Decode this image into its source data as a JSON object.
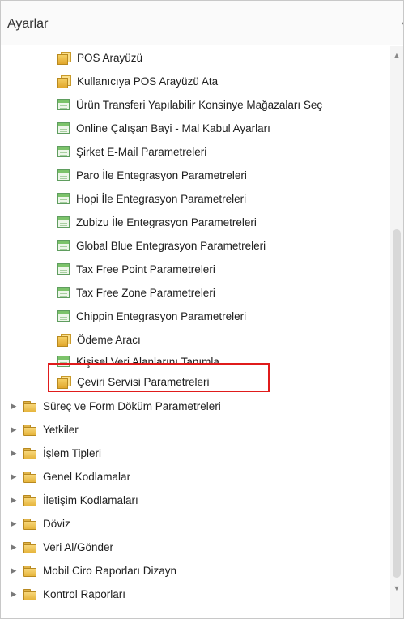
{
  "panel": {
    "title": "Ayarlar",
    "collapse_glyph": "‹"
  },
  "tree": {
    "items": [
      {
        "label": "POS Arayüzü",
        "icon": "book-icon"
      },
      {
        "label": "Kullanıcıya POS Arayüzü Ata",
        "icon": "book-icon"
      },
      {
        "label": "Ürün Transferi Yapılabilir Konsinye Mağazaları Seç",
        "icon": "form-icon"
      },
      {
        "label": "Online Çalışan Bayi - Mal Kabul Ayarları",
        "icon": "form-icon"
      },
      {
        "label": "Şirket E-Mail Parametreleri",
        "icon": "form-icon"
      },
      {
        "label": "Paro İle Entegrasyon Parametreleri",
        "icon": "form-icon"
      },
      {
        "label": "Hopi İle Entegrasyon Parametreleri",
        "icon": "form-icon"
      },
      {
        "label": "Zubizu İle Entegrasyon Parametreleri",
        "icon": "form-icon"
      },
      {
        "label": "Global Blue Entegrasyon Parametreleri",
        "icon": "form-icon"
      },
      {
        "label": "Tax Free Point Parametreleri",
        "icon": "form-icon"
      },
      {
        "label": "Tax Free Zone Parametreleri",
        "icon": "form-icon"
      },
      {
        "label": "Chippin Entegrasyon Parametreleri",
        "icon": "form-icon"
      },
      {
        "label": "Ödeme Aracı",
        "icon": "book-icon"
      },
      {
        "label": "Kişisel Veri Alanlarını Tanımla",
        "icon": "form-icon"
      },
      {
        "label": "Çeviri Servisi Parametreleri",
        "icon": "book-icon",
        "highlighted": true,
        "highlight_color": "#e01b1b"
      }
    ],
    "folders": [
      {
        "label": "Süreç ve Form Döküm Parametreleri",
        "icon": "folder-icon",
        "expander": "▶"
      },
      {
        "label": "Yetkiler",
        "icon": "folder-icon",
        "expander": "▶"
      },
      {
        "label": "İşlem Tipleri",
        "icon": "folder-icon",
        "expander": "▶"
      },
      {
        "label": "Genel Kodlamalar",
        "icon": "folder-icon",
        "expander": "▶"
      },
      {
        "label": "İletişim Kodlamaları",
        "icon": "folder-icon",
        "expander": "▶"
      },
      {
        "label": "Döviz",
        "icon": "folder-icon",
        "expander": "▶"
      },
      {
        "label": "Veri Al/Gönder",
        "icon": "folder-icon",
        "expander": "▶"
      },
      {
        "label": "Mobil Ciro Raporları Dizayn",
        "icon": "folder-icon",
        "expander": "▶"
      },
      {
        "label": "Kontrol Raporları",
        "icon": "folder-icon",
        "expander": "▶"
      }
    ]
  },
  "scrollbar": {
    "up_glyph": "▲",
    "down_glyph": "▼"
  },
  "colors": {
    "highlight_border": "#e01b1b",
    "folder": "#e6b53d",
    "form_header": "#7cc36a"
  }
}
